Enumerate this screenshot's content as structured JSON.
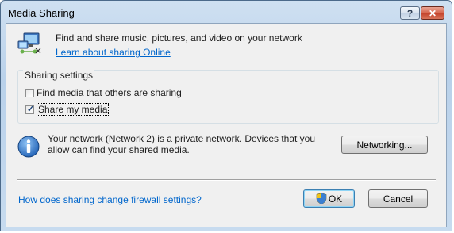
{
  "window": {
    "title": "Media Sharing"
  },
  "titlebar": {
    "help_glyph": "?",
    "close_glyph": "✕"
  },
  "intro": {
    "text": "Find and share music, pictures, and video on your network",
    "link": "Learn about sharing Online",
    "icon": "media-network-icon"
  },
  "sharing_settings": {
    "title": "Sharing settings",
    "options": [
      {
        "label": "Find media that others are sharing",
        "checked": false
      },
      {
        "label": "Share my media",
        "checked": true
      }
    ]
  },
  "network": {
    "info": "Your network (Network  2) is a private network. Devices that you allow can find your shared media.",
    "button": "Networking...",
    "icon": "info-icon"
  },
  "footer": {
    "link": "How does sharing change firewall settings?",
    "ok": "OK",
    "cancel": "Cancel"
  },
  "colors": {
    "link": "#0066cc",
    "close_button": "#c2412a",
    "info": "#1e5fb4"
  }
}
